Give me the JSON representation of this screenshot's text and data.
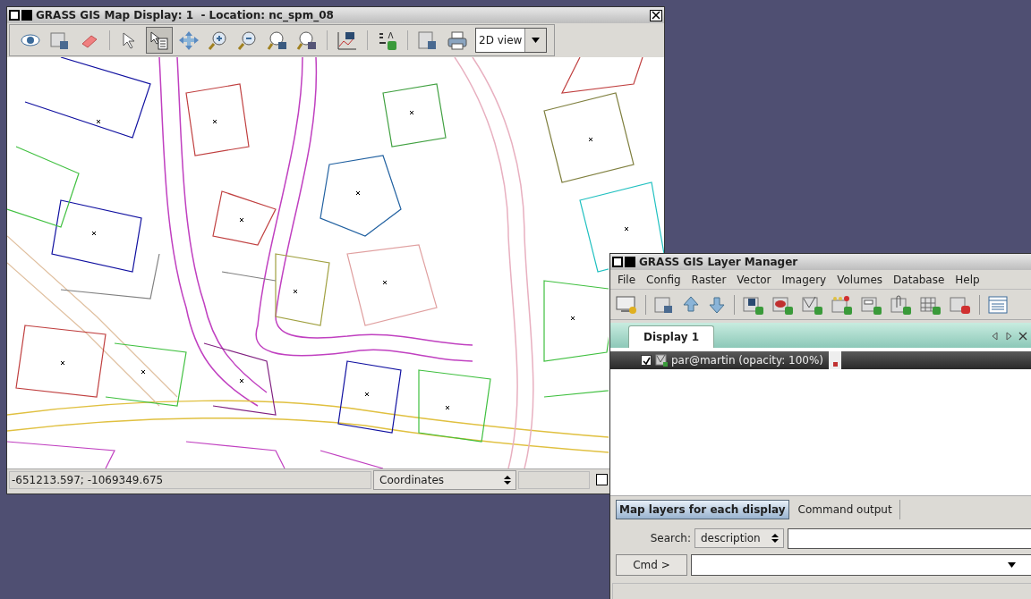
{
  "map_window": {
    "title": "GRASS GIS Map Display: 1  - Location: nc_spm_08",
    "tools": [
      {
        "kind": "display",
        "selected": false
      },
      {
        "kind": "overlay",
        "selected": false
      },
      {
        "kind": "erase",
        "selected": false
      },
      {
        "kind": "pointer",
        "selected": false
      },
      {
        "kind": "query",
        "selected": true
      },
      {
        "kind": "pan",
        "selected": false
      },
      {
        "kind": "zoomin",
        "selected": false
      },
      {
        "kind": "zoomout",
        "selected": false
      },
      {
        "kind": "zoomback",
        "selected": false
      },
      {
        "kind": "zoommenu",
        "selected": false
      },
      {
        "kind": "analyze",
        "selected": false
      },
      {
        "kind": "decorate",
        "selected": false
      },
      {
        "kind": "save",
        "selected": false
      },
      {
        "kind": "print",
        "selected": false
      }
    ],
    "view_mode": "2D view",
    "status": {
      "coordinates": "-651213.597; -1069349.675",
      "mode": "Coordinates",
      "render_checked": false
    }
  },
  "layer_manager": {
    "title": "GRASS GIS Layer Manager",
    "menu": [
      "File",
      "Config",
      "Raster",
      "Vector",
      "Imagery",
      "Volumes",
      "Database",
      "Help"
    ],
    "display_tabs": [
      {
        "label": "Display 1",
        "selected": true
      }
    ],
    "layers": [
      {
        "label": "par@martin (opacity: 100%)",
        "checked": true
      }
    ],
    "bottom_tabs": [
      {
        "label": "Map layers for each display",
        "selected": true
      },
      {
        "label": "Command output",
        "selected": false
      }
    ],
    "search": {
      "label": "Search:",
      "field": "description"
    },
    "cmd_button": "Cmd >"
  }
}
